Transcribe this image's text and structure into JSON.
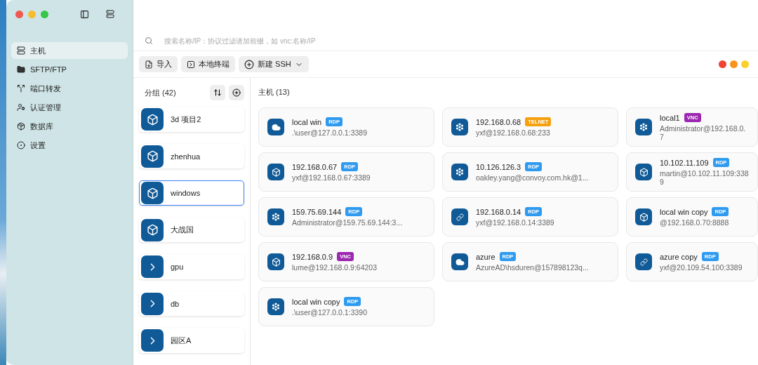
{
  "sidebar": {
    "items": [
      {
        "label": "主机",
        "selected": true
      },
      {
        "label": "SFTP/FTP",
        "selected": false
      },
      {
        "label": "端口转发",
        "selected": false
      },
      {
        "label": "认证管理",
        "selected": false
      },
      {
        "label": "数据库",
        "selected": false
      },
      {
        "label": "设置",
        "selected": false
      }
    ]
  },
  "search": {
    "placeholder": "搜索名称/IP：协议过滤请加前缀，如 vnc:名称/IP"
  },
  "toolbar": {
    "buttons": [
      "导入",
      "本地终端",
      "新建 SSH"
    ]
  },
  "groups": {
    "title": "分组 (42)",
    "items": [
      {
        "label": "3d 项目2",
        "selected": false
      },
      {
        "label": "zhenhua",
        "selected": false
      },
      {
        "label": "windows",
        "selected": true
      },
      {
        "label": "大战国",
        "selected": false
      },
      {
        "label": "gpu",
        "selected": false
      },
      {
        "label": "db",
        "selected": false
      },
      {
        "label": "园区A",
        "selected": false
      }
    ]
  },
  "hosts": {
    "title": "主机 (13)",
    "items": [
      {
        "name": "local win",
        "protocol": "RDP",
        "color": "#2f9bf0",
        "address": ".\\user@127.0.0.1:3389"
      },
      {
        "name": "192.168.0.68",
        "protocol": "TELNET",
        "color": "#f5a00f",
        "address": "yxf@192.168.0.68:233"
      },
      {
        "name": "local1",
        "protocol": "VNC",
        "color": "#9c27b0",
        "address": "Administrator@192.168.0.7"
      },
      {
        "name": "192.168.0.67",
        "protocol": "RDP",
        "color": "#2f9bf0",
        "address": "yxf@192.168.0.67:3389"
      },
      {
        "name": "10.126.126.3",
        "protocol": "RDP",
        "color": "#2f9bf0",
        "address": "oakley.yang@convoy.com.hk@1..."
      },
      {
        "name": "10.102.11.109",
        "protocol": "RDP",
        "color": "#2f9bf0",
        "address": "martin@10.102.11.109:3389"
      },
      {
        "name": "159.75.69.144",
        "protocol": "RDP",
        "color": "#2f9bf0",
        "address": "Administrator@159.75.69.144:3..."
      },
      {
        "name": "192.168.0.14",
        "protocol": "RDP",
        "color": "#2f9bf0",
        "address": "yxf@192.168.0.14:3389"
      },
      {
        "name": "local win copy",
        "protocol": "RDP",
        "color": "#2f9bf0",
        "address": "@192.168.0.70:8888"
      },
      {
        "name": "192.168.0.9",
        "protocol": "VNC",
        "color": "#9c27b0",
        "address": "lume@192.168.0.9:64203"
      },
      {
        "name": "azure",
        "protocol": "RDP",
        "color": "#2f9bf0",
        "address": "AzureAD\\hsduren@157898123q..."
      },
      {
        "name": "azure copy",
        "protocol": "RDP",
        "color": "#2f9bf0",
        "address": "yxf@20.109.54.100:3389"
      },
      {
        "name": "local win copy",
        "protocol": "RDP",
        "color": "#2f9bf0",
        "address": ".\\user@127.0.0.1:3390"
      }
    ]
  }
}
